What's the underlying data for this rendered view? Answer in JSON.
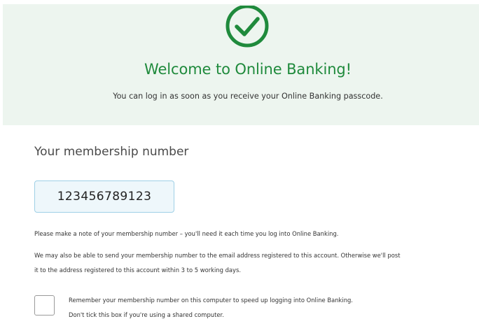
{
  "banner": {
    "icon": "check-circle-icon",
    "title": "Welcome to Online Banking!",
    "subtitle": "You can log in as soon as you receive your Online Banking passcode."
  },
  "membership": {
    "heading": "Your membership number",
    "number": "123456789123",
    "note_1": "Please make a note of your membership number – you'll need it each time you log into Online Banking.",
    "note_2_line_1": "We may also be able to send your membership number to the email address registered to this account. Otherwise we'll post",
    "note_2_line_2": "it to the address registered to this account within 3 to 5 working days."
  },
  "remember": {
    "checked": false,
    "label_line_1": "Remember your membership number on this computer to speed up logging into Online Banking.",
    "label_line_2": "Don't tick this box if you're using a shared computer."
  },
  "colors": {
    "brand_green": "#1f8a3c",
    "banner_background": "#edf5ef",
    "number_box_background": "#eef7fb",
    "number_box_border": "#9fd0e6"
  }
}
